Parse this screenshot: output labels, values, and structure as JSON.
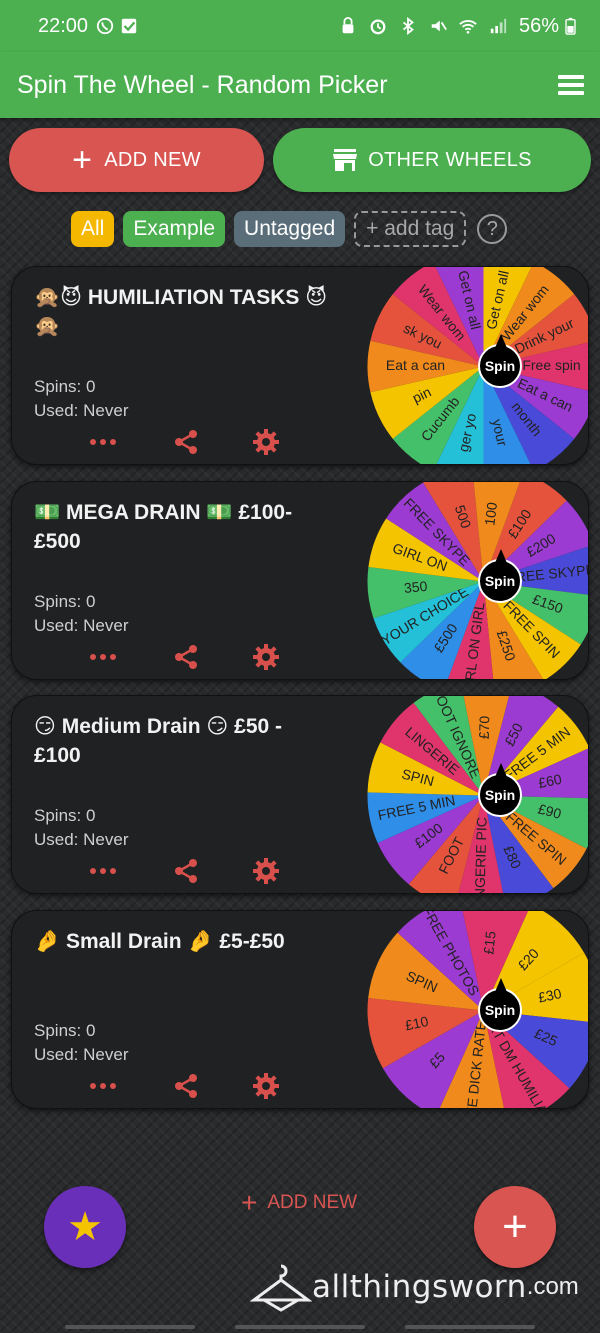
{
  "status": {
    "time": "22:00",
    "battery": "56%"
  },
  "app": {
    "title": "Spin The Wheel - Random Picker"
  },
  "toolbar": {
    "add_new": "ADD NEW",
    "other_wheels": "OTHER WHEELS"
  },
  "tags": {
    "all": "All",
    "example": "Example",
    "untagged": "Untagged",
    "add_tag": "+ add tag",
    "help": "?"
  },
  "wheels": [
    {
      "name": "🙊😈 HUMILIATION TASKS 😈🙊",
      "spins": "Spins: 0",
      "used": "Used: Never",
      "spin_label": "Spin",
      "segments": [
        "Get on all",
        "Wear wom",
        "Drink your",
        "Free spin",
        "Eat a can",
        "month",
        "your",
        "ger yo",
        "Cucumb",
        "pin",
        "Eat a can",
        "sk you",
        "Wear wom",
        "Get on all"
      ],
      "colors": [
        "#f5c400",
        "#f08a1c",
        "#e5533d",
        "#e0356c",
        "#9b3bd1",
        "#4a4ad8",
        "#2f8ee8",
        "#24c0d8",
        "#45c06a",
        "#f5c400",
        "#f08a1c",
        "#e5533d",
        "#e0356c",
        "#9b3bd1"
      ]
    },
    {
      "name": "💵 MEGA DRAIN 💵 £100-£500",
      "spins": "Spins: 0",
      "used": "Used: Never",
      "spin_label": "Spin",
      "segments": [
        "£100",
        "£200",
        "FREE SKYPE",
        "£150",
        "FREE SPIN",
        "£250",
        "GIRL ON GIRL",
        "£500",
        "YOUR CHOICE",
        "350",
        "GIRL ON",
        "FREE SKYPE",
        "500",
        "100"
      ],
      "colors": [
        "#e5533d",
        "#9b3bd1",
        "#4a4ad8",
        "#45c06a",
        "#f5c400",
        "#f08a1c",
        "#e0356c",
        "#2f8ee8",
        "#24c0d8",
        "#45c06a",
        "#f5c400",
        "#9b3bd1",
        "#e5533d",
        "#f08a1c"
      ]
    },
    {
      "name": "😏 Medium Drain 😏 £50 - £100",
      "spins": "Spins: 0",
      "used": "Used: Never",
      "spin_label": "Spin",
      "segments": [
        "FREE 5 MIN",
        "£60",
        "£90",
        "FREE SPIN",
        "£80",
        "LINGERIE PIC",
        "FOOT",
        "£100",
        "FREE 5 MIN",
        "SPIN",
        "LINGERIE",
        "FOOT IGNORE",
        "£70",
        "£50"
      ],
      "colors": [
        "#f5c400",
        "#9b3bd1",
        "#45c06a",
        "#f08a1c",
        "#4a4ad8",
        "#e0356c",
        "#e5533d",
        "#9b3bd1",
        "#2f8ee8",
        "#f5c400",
        "#e0356c",
        "#45c06a",
        "#f08a1c",
        "#9b3bd1"
      ]
    },
    {
      "name": "🤌 Small Drain 🤌 £5-£50",
      "spins": "Spins: 0",
      "used": "Used: Never",
      "spin_label": "Spin",
      "segments": [
        "£30",
        "£25",
        "SHORT DM HUMILIATION",
        "FREE DICK RATE",
        "£5",
        "£10",
        "SPIN",
        "FREE PHOTOS",
        "£15",
        "£20"
      ],
      "colors": [
        "#f5c400",
        "#4a4ad8",
        "#e0356c",
        "#f08a1c",
        "#9b3bd1",
        "#e5533d",
        "#f08a1c",
        "#9b3bd1",
        "#e0356c",
        "#f5c400"
      ]
    }
  ],
  "bottom": {
    "add_new": "ADD NEW",
    "watermark_name": "allthingsworn",
    "watermark_tld": ".com"
  }
}
